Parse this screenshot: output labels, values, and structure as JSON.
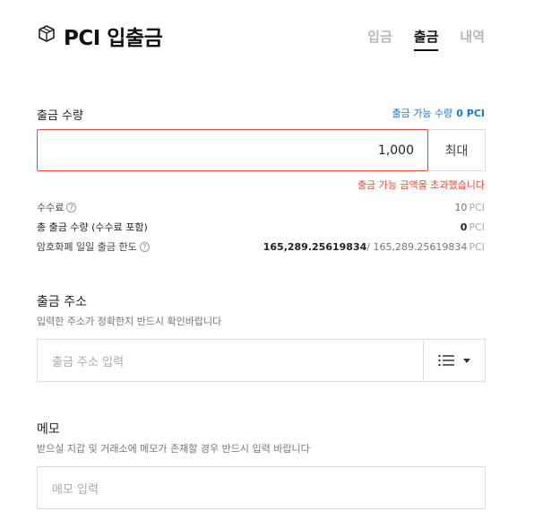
{
  "header": {
    "logo_icon": "box-logo-icon",
    "title": "PCI 입출금",
    "tabs": [
      {
        "label": "입금",
        "active": false
      },
      {
        "label": "출금",
        "active": true
      },
      {
        "label": "내역",
        "active": false
      }
    ]
  },
  "amount": {
    "label": "출금 수량",
    "available_label": "출금 가능 수량",
    "available_value": "0 PCI",
    "input_value": "1,000",
    "max_label": "최대",
    "error": "출금 가능 금액을 초과했습니다"
  },
  "info": {
    "fee_label": "수수료",
    "fee_value": "10",
    "total_label": "총 출금 수량 (수수료 포함)",
    "total_value": "0",
    "limit_label": "암호화폐 일일 출금 한도",
    "limit_used": "165,289.25619834",
    "limit_total": "/ 165,289.25619834",
    "unit": "PCI"
  },
  "address": {
    "title": "출금 주소",
    "desc": "입력한 주소가 정확한지 반드시 확인바랍니다",
    "placeholder": "출금 주소 입력"
  },
  "memo": {
    "title": "메모",
    "desc": "받으실 지갑 및 거래소에 메모가 존재할 경우 반드시 입력 바랍니다",
    "placeholder": "메모 입력"
  },
  "colors": {
    "accent": "#1a73d9",
    "error": "#e34a3a",
    "border": "#dcdcdc"
  }
}
